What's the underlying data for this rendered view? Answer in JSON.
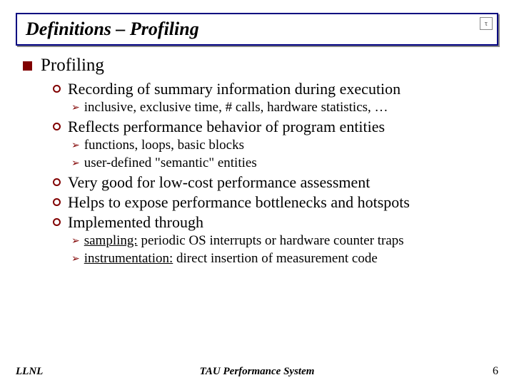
{
  "title": "Definitions – Profiling",
  "logo_glyph": "τ",
  "outline": {
    "lvl1": "Profiling",
    "items": [
      {
        "text": "Recording of summary information during execution",
        "sub": [
          {
            "text": "inclusive, exclusive time, # calls, hardware statistics, …"
          }
        ]
      },
      {
        "text": "Reflects performance behavior of program entities",
        "sub": [
          {
            "text": "functions, loops, basic blocks"
          },
          {
            "text": "user-defined \"semantic\" entities"
          }
        ]
      },
      {
        "text": "Very good for low-cost performance assessment",
        "sub": []
      },
      {
        "text": "Helps to expose performance bottlenecks and hotspots",
        "sub": []
      },
      {
        "text": "Implemented through",
        "sub": [
          {
            "lead": "sampling:",
            "rest": " periodic OS interrupts or hardware counter traps"
          },
          {
            "lead": "instrumentation:",
            "rest": " direct insertion of measurement code"
          }
        ]
      }
    ]
  },
  "footer": {
    "left": "LLNL",
    "center": "TAU Performance System",
    "right": "6"
  }
}
